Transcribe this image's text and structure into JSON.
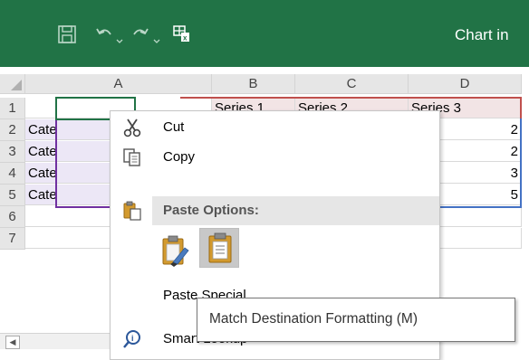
{
  "app": {
    "title": "Chart in",
    "accent": "#217346"
  },
  "qat": {
    "icons": [
      "save-icon",
      "undo-icon",
      "redo-icon",
      "calculator-icon"
    ]
  },
  "sheet": {
    "columns": [
      "A",
      "B",
      "C",
      "D"
    ],
    "rows": [
      "1",
      "2",
      "3",
      "4",
      "5",
      "6",
      "7"
    ],
    "header_row": [
      "",
      "Series 1",
      "Series 2",
      "Series 3"
    ],
    "categories": [
      "Cate",
      "Cate",
      "Cate",
      "Cate"
    ],
    "d_values": [
      "2",
      "2",
      "3",
      "5"
    ]
  },
  "context_menu": {
    "cut": "Cut",
    "copy": "Copy",
    "paste_options": "Paste Options:",
    "paste_special": "Paste Special...",
    "smart_lookup": "Smart Lookup"
  },
  "tooltip": {
    "text": "Match Destination Formatting (M)"
  },
  "colors": {
    "series1": "#c0504d",
    "series2": "#7030a0",
    "series3": "#4472c4"
  }
}
